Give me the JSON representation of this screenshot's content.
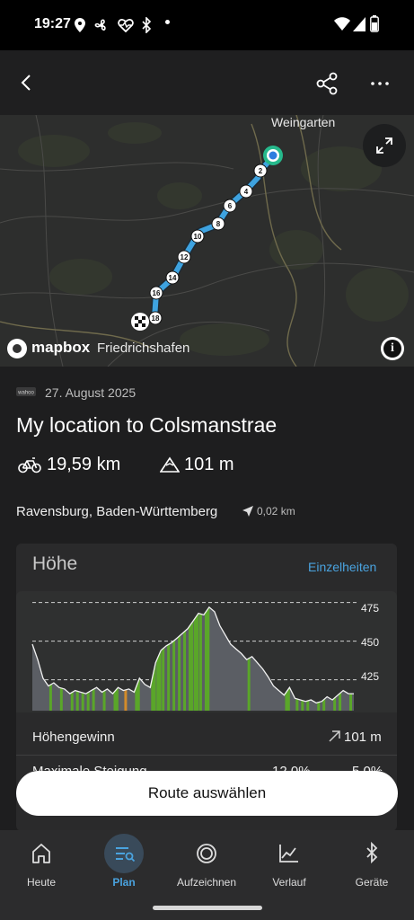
{
  "status_bar": {
    "time": "19:27",
    "icons": [
      "location-icon",
      "fan-icon",
      "heart-monitor-icon",
      "bluetooth-icon",
      "dot-icon",
      "wifi-icon",
      "signal-icon",
      "battery-icon"
    ]
  },
  "app_bar": {
    "icons": [
      "back-icon",
      "share-icon",
      "more-icon"
    ]
  },
  "map": {
    "place_top": "Weingarten",
    "place_bottom": "Friedrichshafen",
    "brand": "mapbox",
    "markers": [
      "2",
      "4",
      "6",
      "8",
      "10",
      "12",
      "14",
      "16",
      "18"
    ],
    "route_color": "#3ea3e0"
  },
  "route": {
    "source_logo": "wahoo",
    "date": "27. August 2025",
    "title": "My location to Colsmanstrae",
    "distance": "19,59 km",
    "climb": "101 m",
    "location": "Ravensburg, Baden-Württemberg",
    "location_distance": "0,02 km"
  },
  "elevation": {
    "heading": "Höhe",
    "details_link": "Einzelheiten",
    "gain_label": "Höhengewinn",
    "gain_value": "101 m",
    "max_slope_label": "Maximale Steigung",
    "max_slope_up": "12,0%",
    "max_slope_down": "5,0%"
  },
  "chart_data": {
    "type": "area",
    "ytick_labels": [
      "475",
      "450",
      "425"
    ],
    "ylim": [
      405,
      480
    ],
    "x": [
      0,
      1,
      2,
      3,
      4,
      5,
      6,
      7,
      8,
      9,
      10,
      11,
      12,
      13,
      14,
      15,
      16,
      17,
      18,
      19,
      20,
      21,
      22,
      23,
      24,
      25,
      26,
      27,
      28,
      29,
      30,
      31,
      32,
      33,
      34,
      35,
      36,
      37,
      38,
      39,
      40,
      41,
      42,
      43,
      44,
      45,
      46,
      47,
      48,
      49,
      50,
      51,
      52,
      53,
      54,
      55,
      56,
      57,
      58,
      59,
      60
    ],
    "values": [
      448,
      438,
      426,
      421,
      423,
      420,
      419,
      416,
      418,
      417,
      416,
      418,
      420,
      417,
      419,
      416,
      420,
      418,
      419,
      417,
      426,
      422,
      420,
      436,
      444,
      447,
      449,
      452,
      455,
      458,
      463,
      468,
      467,
      472,
      469,
      460,
      454,
      448,
      445,
      442,
      438,
      440,
      436,
      432,
      427,
      421,
      418,
      415,
      420,
      413,
      412,
      411,
      412,
      410,
      411,
      414,
      412,
      415,
      418,
      416,
      416
    ],
    "grid": true,
    "fill_color": "#5b5e64",
    "accent_colors": [
      "#5aa629",
      "#d38b2a"
    ]
  },
  "cta": {
    "label": "Route auswählen"
  },
  "nav": {
    "items": [
      {
        "label": "Heute",
        "icon": "home-icon"
      },
      {
        "label": "Plan",
        "icon": "plan-list-icon",
        "active": true
      },
      {
        "label": "Aufzeichnen",
        "icon": "record-icon"
      },
      {
        "label": "Verlauf",
        "icon": "history-chart-icon"
      },
      {
        "label": "Geräte",
        "icon": "bluetooth-icon"
      }
    ]
  }
}
